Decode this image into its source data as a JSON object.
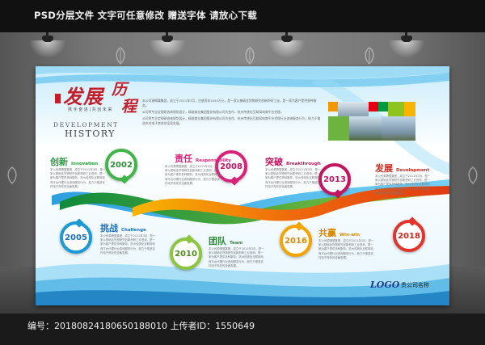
{
  "banner": {
    "promo": "PSD分层文件   文字可任意修改   赠送字体   请放心下载"
  },
  "board": {
    "title": {
      "cn_main": "发展",
      "cn_accent_1": "历",
      "cn_accent_2": "程",
      "slogan": "携 手 奋 进  |  共 创 未 来",
      "en_line1": "DEVELOPMENT",
      "en_line2": "HISTORY"
    },
    "intro": [
      "本公司源揭翼集团，成立于2011年3月，注册资本1000万元，是一家以基础含货物研究创新积研工业，是一家为客户提供多种服务。",
      "公司将专业定规研咨询规划设计，精准商业集团股份有限公司为合作，杭州传统化互联网电商平台代理。",
      "公司将专业定规研咨询规划设计，精准商业集团股份有限公司为合作，杭州传统化互联网电商平台代理行业咨询服务行为，致力于推进农村电子商务的全面发展。"
    ],
    "timeline": [
      {
        "year": "2002",
        "cn": "创新",
        "en": "Innovation",
        "text": "本公司源揭翼集团，成立于2011年3月，是一家以基础含货物研究创新积研工业咨询，是一家为客户提供多种服务；杭州传统化互联网电商平台代理行业咨询服务行为，致力于推进农村电子商务的全面发展。"
      },
      {
        "year": "2005",
        "cn": "挑战",
        "en": "Challenge",
        "text": "本公司源揭翼集团，成立于2011年3月，是一家以基础含货物研究创新积研工业咨询，是一家为客户提供多种服务；杭州传统化互联网电商平台代理行业咨询服务行为，致力于推进农村电子商务的全面发展。"
      },
      {
        "year": "2008",
        "cn": "责任",
        "en": "Responsibility",
        "text": "本公司源揭翼集团，成立于2011年3月，是一家以基础含货物研究创新积研工业咨询，是一家为客户提供多种服务；杭州传统化互联网电商平台代理行业咨询服务行为，致力于推进农村电子商务的全面发展。"
      },
      {
        "year": "2010",
        "cn": "团队",
        "en": "Team",
        "text": "本公司源揭翼集团，成立于2011年3月，是一家以基础含货物研究创新积研工业咨询，是一家为客户提供多种服务；杭州传统化互联网电商平台代理行业咨询服务行为，致力于推进农村电子商务的全面发展。"
      },
      {
        "year": "2013",
        "cn": "突破",
        "en": "Breakthrough",
        "text": "本公司源揭翼集团，成立于2011年3月，是一家以基础含货物研究创新积研工业咨询，是一家为客户提供多种服务；杭州传统化互联网电商平台代理行业咨询服务行为，致力于推进农村电子商务的全面发展。"
      },
      {
        "year": "2016",
        "cn": "共赢",
        "en": "Win-win",
        "text": "本公司源揭翼集团，成立于2011年3月，是一家以基础含货物研究创新积研工业咨询，是一家为客户提供多种服务；杭州传统化互联网电商平台代理行业咨询服务行为，致力于推进农村电子商务的全面发展。"
      },
      {
        "year": "2018",
        "cn": "发展",
        "en": "Development",
        "text": "本公司源揭翼集团，成立于2011年3月，是一家以基础含货物研究创新积研工业咨询，是一家为客户提供多种服务；杭州传统化互联网电商平台代理行业咨询服务行为，致力于推进农村电子商务的全面发展。"
      }
    ],
    "logo": "LOGO",
    "company": "贵公司名称"
  },
  "footer": {
    "info": "编号：20180824180650188010 上传者ID：1550649"
  }
}
